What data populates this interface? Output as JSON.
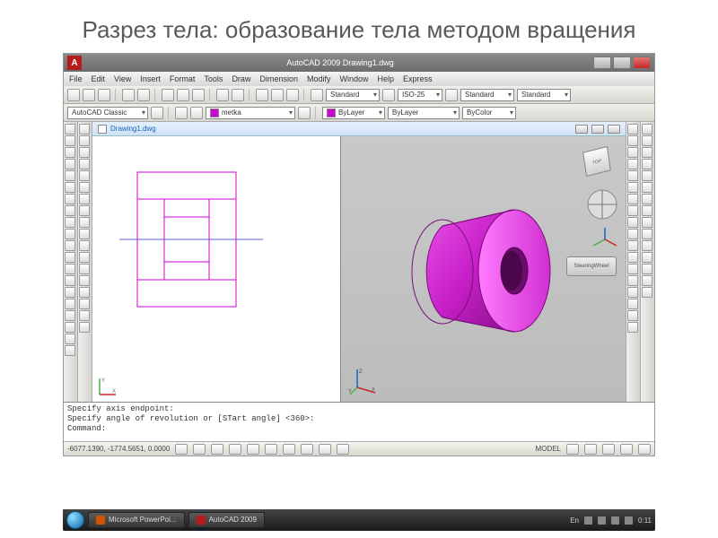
{
  "slide": {
    "title": "Разрез тела: образование тела методом вращения"
  },
  "app": {
    "name": "A",
    "title": "AutoCAD 2009 Drawing1.dwg",
    "menu": [
      "File",
      "Edit",
      "View",
      "Insert",
      "Format",
      "Tools",
      "Draw",
      "Dimension",
      "Modify",
      "Window",
      "Help",
      "Express"
    ],
    "workspace": "AutoCAD Classic",
    "layer": "metka",
    "linetype": "ByLayer",
    "linecolor": "ByColor",
    "style1": "Standard",
    "dimstyle": "ISO-25",
    "tablestyle": "Standard",
    "textstyle": "Standard",
    "doc_tab": "Drawing1.dwg",
    "viewcube_face": "TOP",
    "steering": "SteeringWheel",
    "command": {
      "line1": "Specify axis endpoint:",
      "line2": "Specify angle of revolution or [STart angle] <360>:",
      "prompt": "Command:"
    },
    "status": {
      "coords": "-6077.1390, -1774.5651, 0.0000",
      "mode": "MODEL"
    }
  },
  "taskbar": {
    "item1": "Microsoft PowerPoi...",
    "item2": "AutoCAD 2009",
    "lang": "En",
    "time": "0:11"
  }
}
